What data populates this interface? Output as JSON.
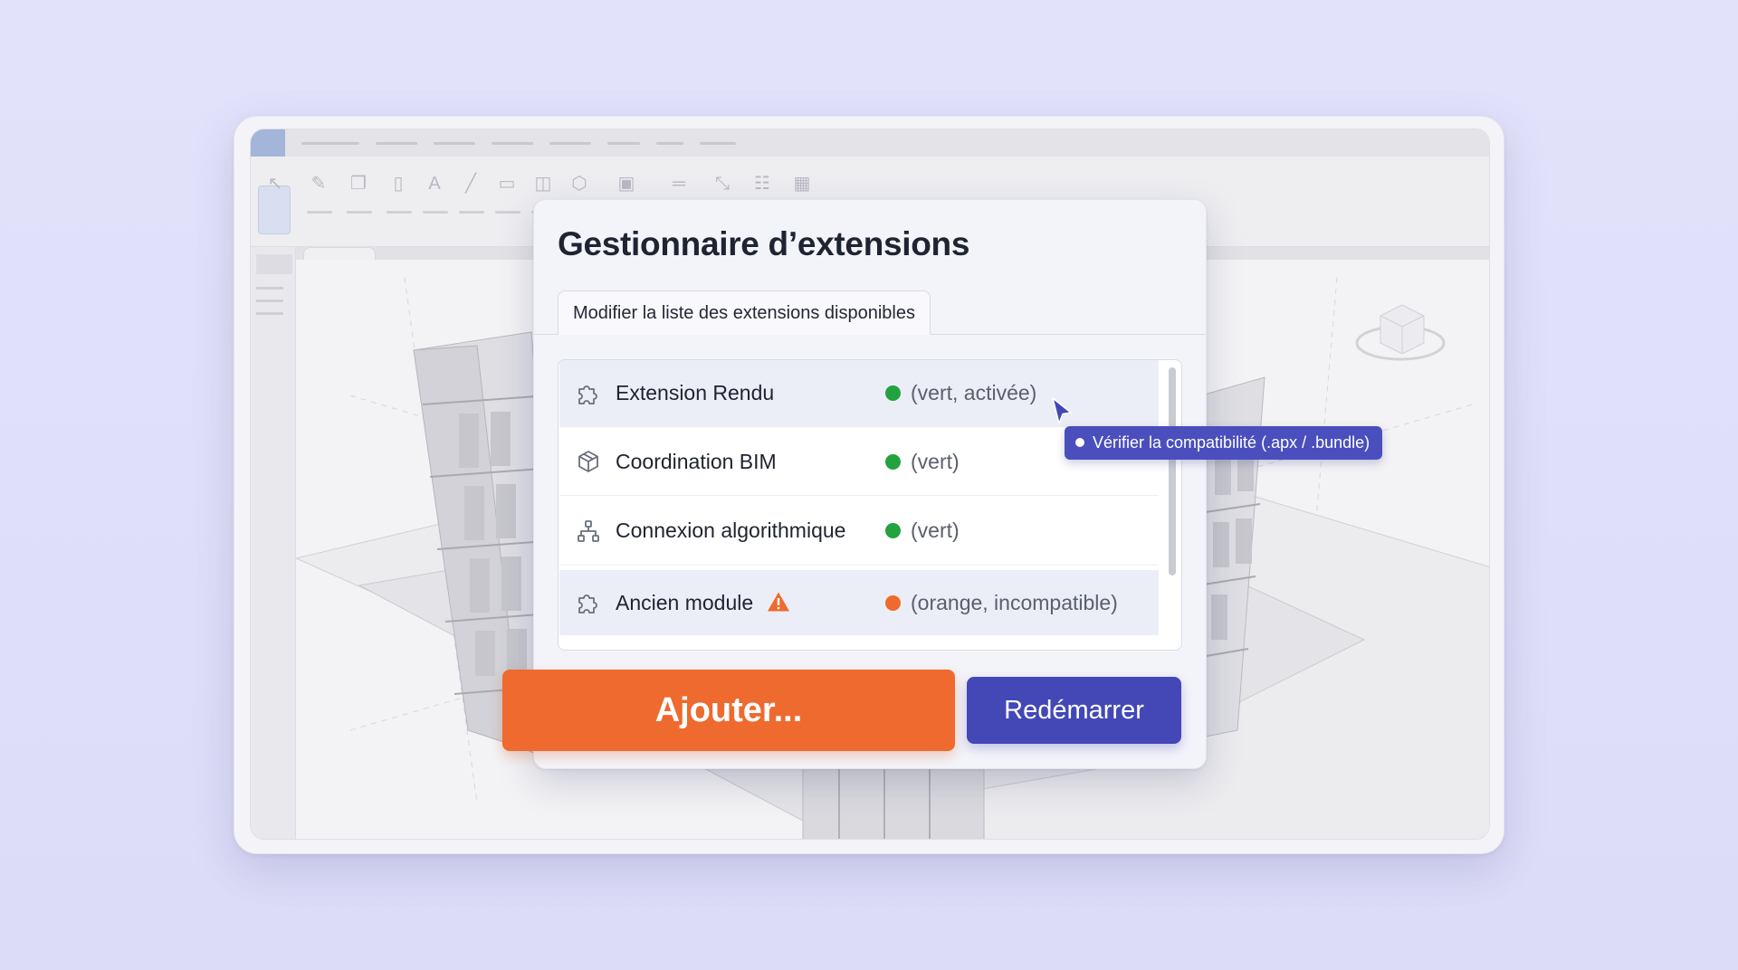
{
  "dialog": {
    "title": "Gestionnaire d’extensions",
    "tab_label": "Modifier la liste des extensions disponibles",
    "extensions": [
      {
        "name": "Extension Rendu",
        "status": "(vert, activée)",
        "status_color": "#22a33f",
        "icon": "puzzle-icon",
        "warning": false
      },
      {
        "name": "Coordination BIM",
        "status": "(vert)",
        "status_color": "#22a33f",
        "icon": "cube-icon",
        "warning": false
      },
      {
        "name": "Connexion algorithmique",
        "status": "(vert)",
        "status_color": "#22a33f",
        "icon": "node-tree-icon",
        "warning": false
      },
      {
        "name": "Ancien module",
        "status": "(orange, incompatible)",
        "status_color": "#ef6a2c",
        "icon": "puzzle-icon",
        "warning": true
      }
    ],
    "add_button": "Ajouter...",
    "restart_button": "Redémarrer"
  },
  "tooltip": {
    "text": "Vérifier la compatibilité (.apx / .bundle)"
  },
  "colors": {
    "accent_orange": "#ee6a2e",
    "accent_indigo": "#4348b6",
    "status_green": "#22a33f",
    "status_orange": "#ef6a2c"
  }
}
